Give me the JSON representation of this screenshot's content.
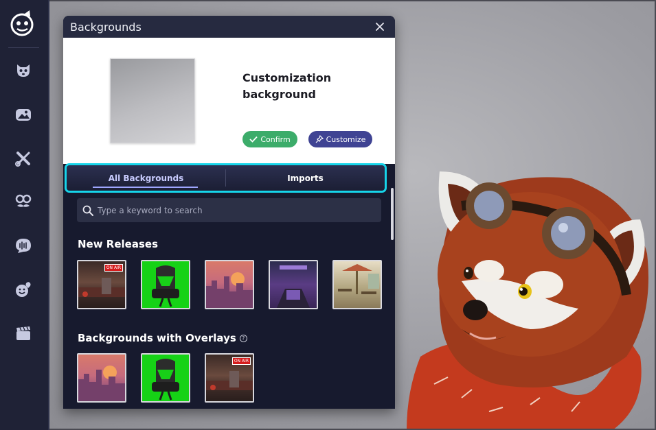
{
  "window": {
    "title": "Backgrounds"
  },
  "preview": {
    "name": "Customization background",
    "confirm_label": "Confirm",
    "customize_label": "Customize"
  },
  "tabs": [
    {
      "label": "All Backgrounds",
      "active": true
    },
    {
      "label": "Imports",
      "active": false
    }
  ],
  "search": {
    "placeholder": "Type a keyword to search",
    "value": ""
  },
  "sections": {
    "new_releases": {
      "title": "New Releases",
      "items": [
        "studio-on-air",
        "green-screen-chair",
        "sunset-city",
        "purple-room",
        "cafe-terrace"
      ]
    },
    "overlays": {
      "title": "Backgrounds with Overlays",
      "items": [
        "sunset-city",
        "green-screen-chair",
        "studio-on-air"
      ]
    }
  },
  "thumb_badges": {
    "on_air": "ON AIR"
  },
  "sidebar": {
    "items": [
      "avatar-icon",
      "background-icon",
      "tools-icon",
      "face-props-icon",
      "voice-icon",
      "emotes-icon",
      "scenes-icon"
    ]
  },
  "colors": {
    "accent_cyan": "#16d5ea",
    "confirm_green": "#3cac6a",
    "customize_indigo": "#3f4393",
    "panel_bg": "#171a2e",
    "sidebar_bg": "#1f2236"
  }
}
